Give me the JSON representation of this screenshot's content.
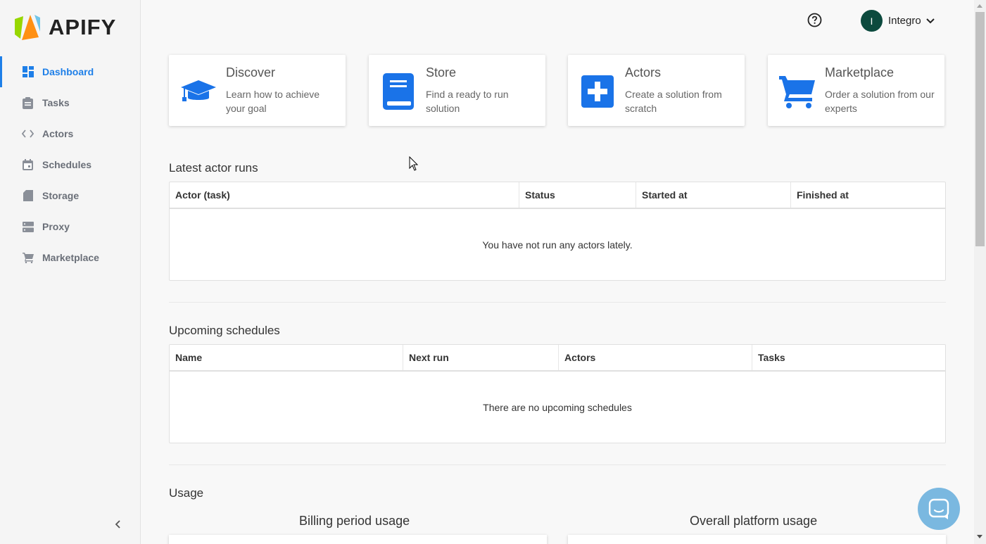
{
  "brand": {
    "name": "APIFY"
  },
  "sidebar": {
    "items": [
      {
        "label": "Dashboard",
        "icon": "dashboard-icon",
        "active": true
      },
      {
        "label": "Tasks",
        "icon": "clipboard-icon"
      },
      {
        "label": "Actors",
        "icon": "code-icon"
      },
      {
        "label": "Schedules",
        "icon": "calendar-icon"
      },
      {
        "label": "Storage",
        "icon": "sd-card-icon"
      },
      {
        "label": "Proxy",
        "icon": "server-icon"
      },
      {
        "label": "Marketplace",
        "icon": "cart-icon"
      }
    ]
  },
  "header": {
    "user": {
      "initial": "I",
      "name": "Integro"
    }
  },
  "cards": [
    {
      "title": "Discover",
      "description": "Learn how to achieve your goal",
      "icon": "graduation-cap-icon"
    },
    {
      "title": "Store",
      "description": "Find a ready to run solution",
      "icon": "book-icon"
    },
    {
      "title": "Actors",
      "description": "Create a solution from scratch",
      "icon": "plus-square-icon"
    },
    {
      "title": "Marketplace",
      "description": "Order a solution from our experts",
      "icon": "shopping-cart-icon"
    }
  ],
  "latest_runs": {
    "title": "Latest actor runs",
    "columns": [
      "Actor (task)",
      "Status",
      "Started at",
      "Finished at"
    ],
    "empty_message": "You have not run any actors lately."
  },
  "schedules": {
    "title": "Upcoming schedules",
    "columns": [
      "Name",
      "Next run",
      "Actors",
      "Tasks"
    ],
    "empty_message": "There are no upcoming schedules"
  },
  "usage": {
    "title": "Usage",
    "billing_title": "Billing period usage",
    "overall_title": "Overall platform usage"
  },
  "colors": {
    "accent": "#1e7fe8",
    "icon_blue": "#1a73e8",
    "avatar": "#0c4a3e",
    "chat": "#7ab8e0"
  }
}
